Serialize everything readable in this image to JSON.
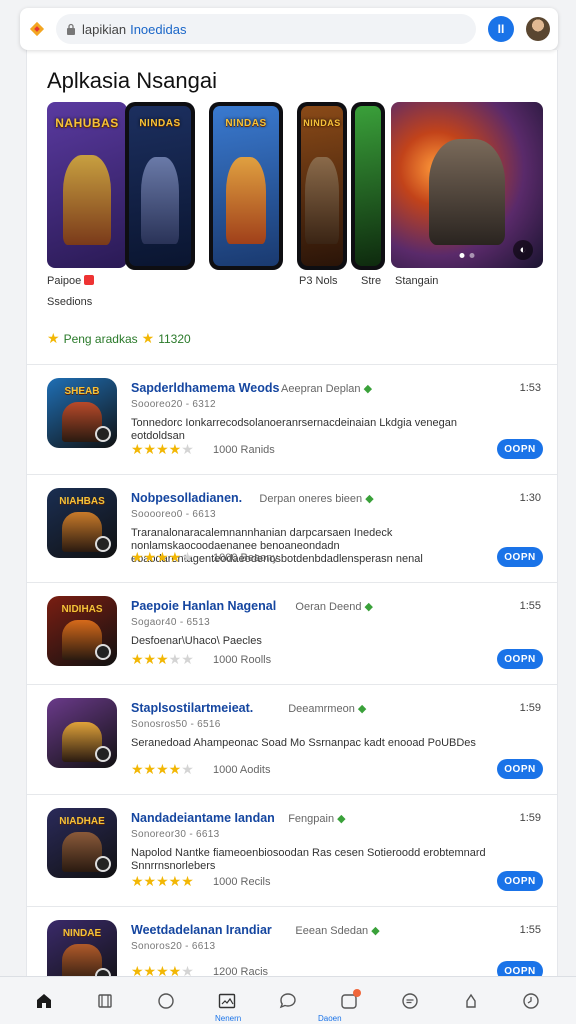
{
  "browser": {
    "url_host": "lapikian",
    "url_path": "Inoedidas",
    "menu_label": "II"
  },
  "featured": {
    "title": "Aplkasia Nsangai",
    "captions": [
      {
        "text": "Paipoe"
      },
      {
        "text": "Ssedions"
      },
      {
        "text": "P3 Nols"
      },
      {
        "text": "Stre"
      },
      {
        "text": "Stangain"
      }
    ],
    "screens": [
      {
        "art_title": "NAHUBAS",
        "bg": "#3a2a7a"
      },
      {
        "art_title": "NINDAS",
        "bg": "#1c2f5f"
      },
      {
        "art_title": "NINDAS",
        "bg": "#2a5fb0"
      },
      {
        "art_title": "NINDAS",
        "bg": "#4a2a14"
      },
      {
        "art_title": "",
        "bg": "#1e3f1a"
      },
      {
        "art_title": "",
        "bg": "#5a2a4a"
      }
    ],
    "rating_label": "Peng aradkas",
    "rating_value": "11320"
  },
  "apps": [
    {
      "name": "Sapderldhamema Weods",
      "dev": "Aeepran Deplan",
      "size": "1:53",
      "meta": "Soooreo20 - 6312",
      "desc": "Tonnedorc Ionkarrecodsolanoeranrsernacdeinaian Lkdgia venegan eotdoldsan",
      "stars": 4,
      "reviews": "1000 Ranids",
      "button": "OOPN",
      "icon_title": "SHEAB",
      "icon_bg": "#1f6fb5",
      "icon_fig": "#b84a2a"
    },
    {
      "name": "Nobpesolladianen.",
      "dev": "Derpan oneres bieen",
      "size": "1:30",
      "meta": "Sooooreo0 - 6613",
      "desc": "Traranalonaracalemnannhanian darpcarsaen Inedeck nonlamskaocoodaenanee benoaneondadn eoaodarentagenteodaeodenosbotdenbdadlensperasn nenal",
      "stars": 4,
      "reviews": "1000 Beaony",
      "button": "OOPN",
      "icon_title": "NIAHBAS",
      "icon_bg": "#1a2e52",
      "icon_fig": "#c87a2a"
    },
    {
      "name": "Paepoie Hanlan Nagenal",
      "dev": "Oeran Deend",
      "size": "1:55",
      "meta": "Sogaor40 - 6513",
      "desc": "Desfoenar\\Uhaco\\ Paecles",
      "stars": 3,
      "reviews": "1000 Roolls",
      "button": "OOPN",
      "icon_title": "NIDIHAS",
      "icon_bg": "#7a1e12",
      "icon_fig": "#d66a1a"
    },
    {
      "name": "Staplsostilartmeieat.",
      "dev": "Deeamrmeon",
      "size": "1:59",
      "meta": "Sonosros50 - 6516",
      "desc": "Seranedoad Ahampeonac Soad Mo Ssrnanpac kadt enooad PoUBDes",
      "stars": 4,
      "reviews": "1000 Aodits",
      "button": "OOPN",
      "icon_title": "",
      "icon_bg": "#6a3a8a",
      "icon_fig": "#e0a23a"
    },
    {
      "name": "Nandadeiantame Iandan",
      "dev": "Fengpain",
      "size": "1:59",
      "meta": "Sonoreor30 - 6613",
      "desc": "Napolod Nantke fiameoenbiosoodan Ras cesen Sotieroodd erobtemnard Snnrrnsnorlebers",
      "stars": 5,
      "reviews": "1000 Recils",
      "button": "OOPN",
      "icon_title": "NIADHAE",
      "icon_bg": "#2a2a5a",
      "icon_fig": "#8a5a3a"
    },
    {
      "name": "Weetdadelanan Irandiar",
      "dev": "Eeean Sdedan",
      "size": "1:55",
      "meta": "Sonoros20 - 6613",
      "desc": "",
      "stars": 4,
      "reviews": "1200 Racis",
      "button": "OOPN",
      "icon_title": "NINDAE",
      "icon_bg": "#3a2a6a",
      "icon_fig": "#b05a2a"
    }
  ],
  "nav": {
    "items": [
      "home-icon",
      "bookmark-icon",
      "circle-icon",
      "image-icon",
      "chat-icon",
      "notification-icon",
      "message-icon",
      "profile-icon",
      "clock-icon"
    ],
    "label_left": "Nenern",
    "label_right": "Daoen"
  },
  "colors": {
    "accent": "#1a73e8",
    "title_link": "#1546a0",
    "star": "#f2b705"
  }
}
